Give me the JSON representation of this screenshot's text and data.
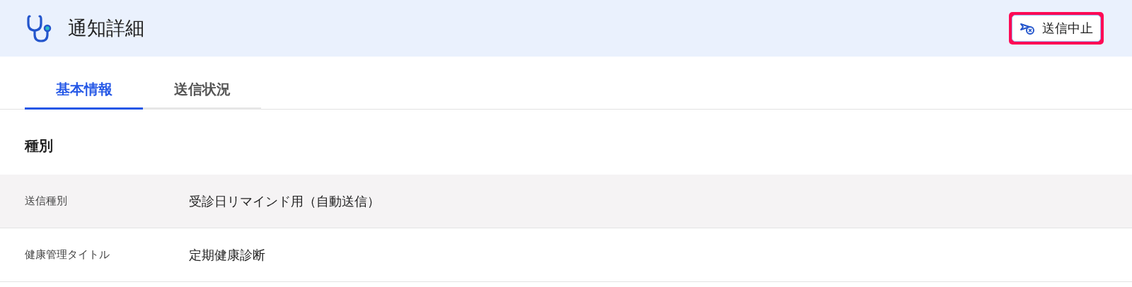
{
  "header": {
    "title": "通知詳細",
    "action": {
      "label": "送信中止",
      "highlighted": true
    }
  },
  "tabs": [
    {
      "label": "基本情報",
      "selected": true
    },
    {
      "label": "送信状況",
      "selected": false
    }
  ],
  "section": {
    "title": "種別",
    "rows": [
      {
        "label": "送信種別",
        "value": "受診日リマインド用（自動送信）",
        "shaded": true
      },
      {
        "label": "健康管理タイトル",
        "value": "定期健康診断",
        "shaded": false
      }
    ]
  }
}
